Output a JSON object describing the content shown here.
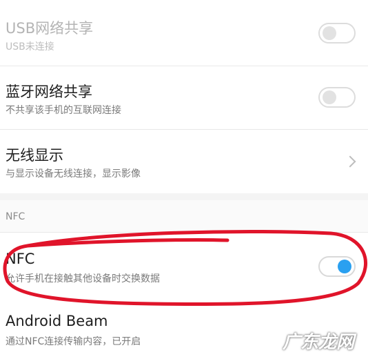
{
  "settings": {
    "usb_tether": {
      "title": "USB网络共享",
      "subtitle": "USB未连接",
      "enabled": false
    },
    "bt_tether": {
      "title": "蓝牙网络共享",
      "subtitle": "不共享该手机的互联网连接",
      "enabled": false
    },
    "wireless_display": {
      "title": "无线显示",
      "subtitle": "与显示设备无线连接，显示影像"
    },
    "nfc_section": {
      "label": "NFC"
    },
    "nfc": {
      "title": "NFC",
      "subtitle": "允许手机在接触其他设备时交换数据",
      "enabled": true
    },
    "android_beam": {
      "title": "Android Beam",
      "subtitle": "通过NFC连接传输内容，已开启"
    }
  },
  "watermark": "广东龙网",
  "colors": {
    "toggle_on": "#2aa0f0",
    "annotation_red": "#e0142a"
  }
}
